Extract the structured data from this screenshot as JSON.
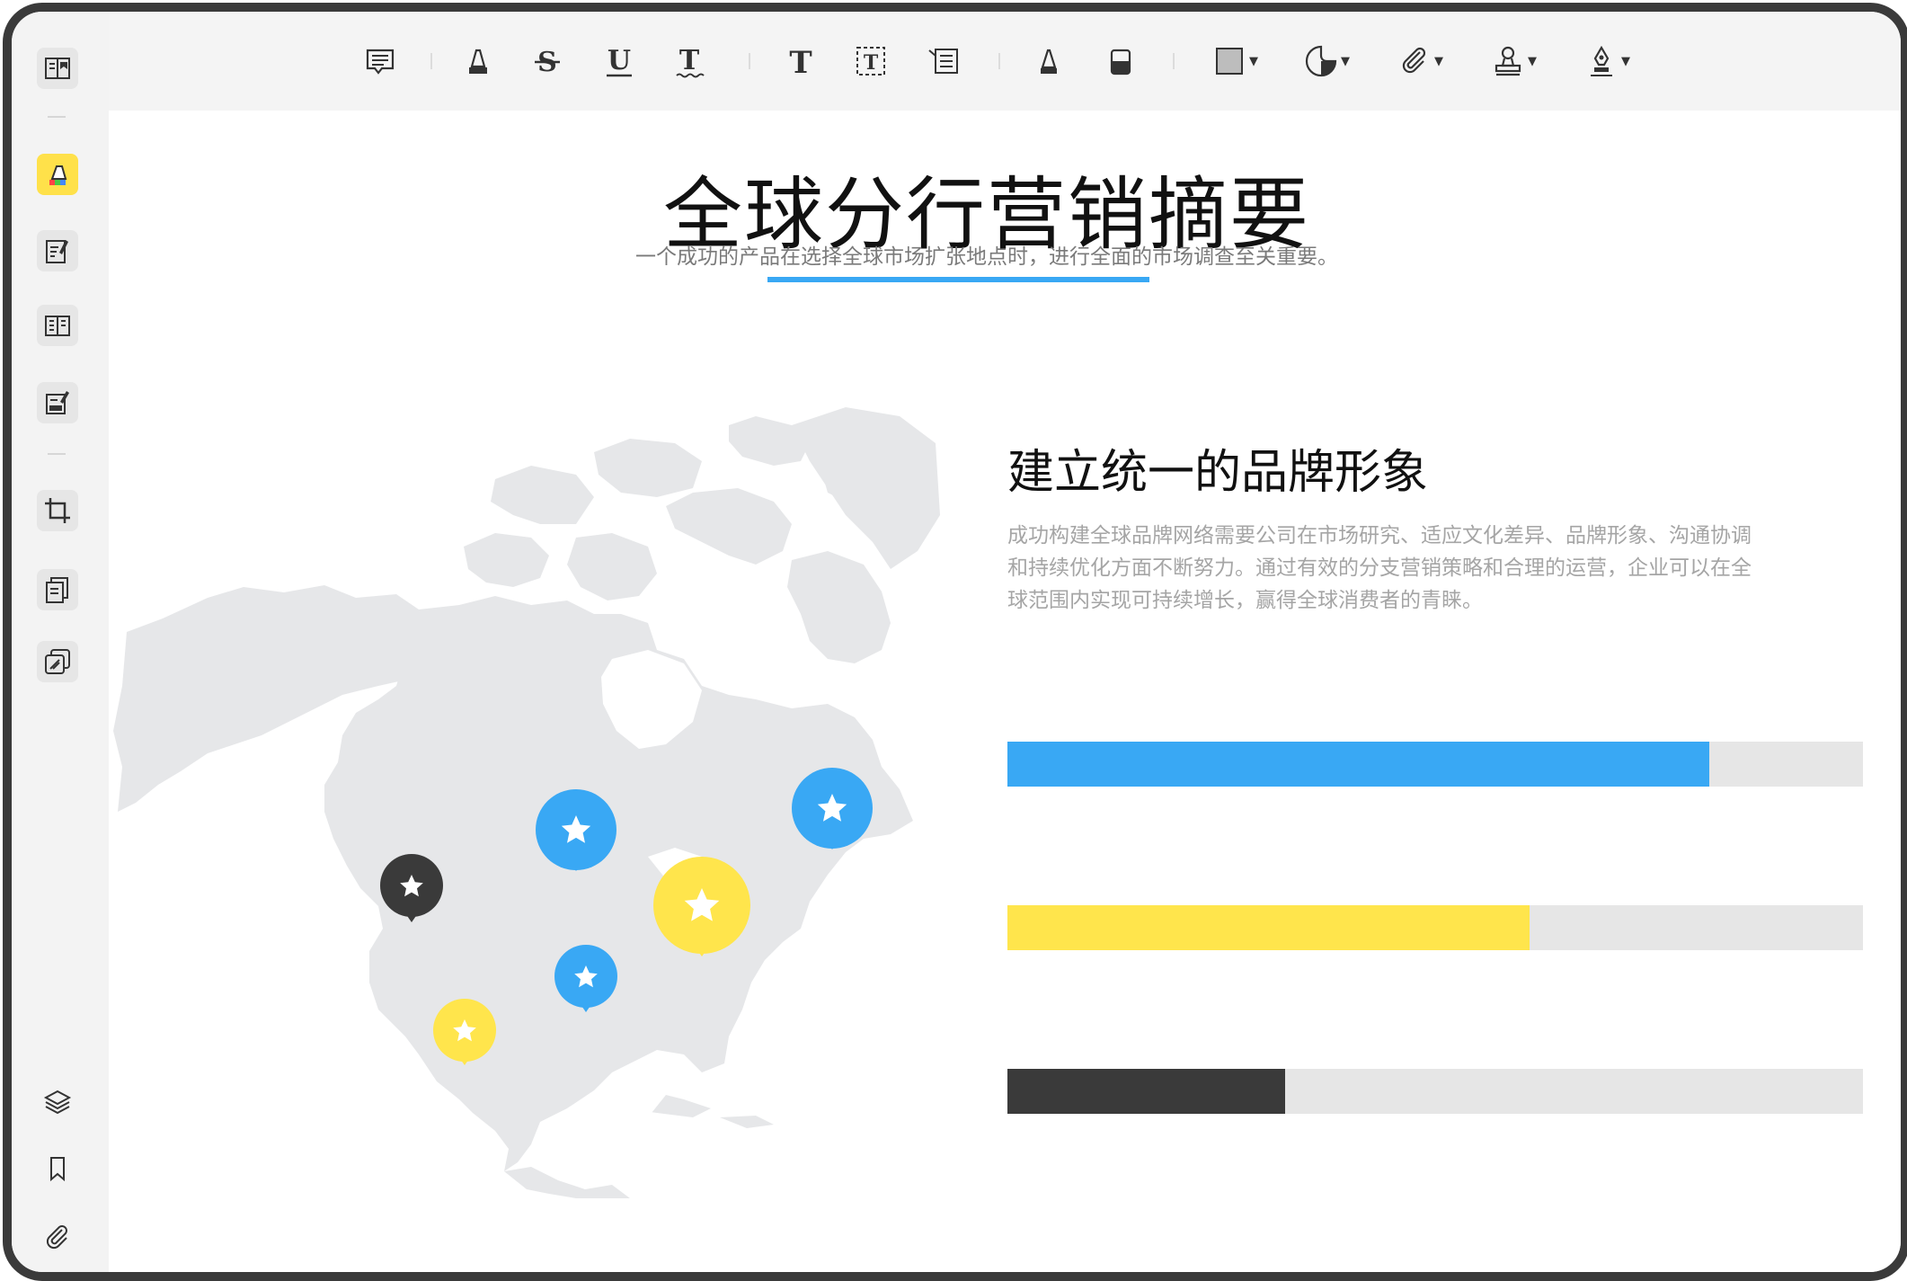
{
  "toolbar": {
    "tools": [
      {
        "name": "note-icon"
      },
      {
        "name": "highlight-icon"
      },
      {
        "name": "strikethrough-icon"
      },
      {
        "name": "underline-icon"
      },
      {
        "name": "squiggly-icon"
      },
      {
        "name": "text-icon"
      },
      {
        "name": "textbox-icon"
      },
      {
        "name": "callout-icon"
      },
      {
        "name": "pen-icon"
      },
      {
        "name": "eraser-icon"
      },
      {
        "name": "shape-icon"
      },
      {
        "name": "sticker-icon"
      },
      {
        "name": "attachment-icon"
      },
      {
        "name": "stamp-icon"
      },
      {
        "name": "signature-icon"
      }
    ]
  },
  "sidebar": {
    "items": [
      {
        "name": "reader-icon"
      },
      {
        "name": "comment-mode-icon",
        "active": true
      },
      {
        "name": "edit-icon"
      },
      {
        "name": "organize-pages-icon"
      },
      {
        "name": "fill-sign-icon"
      },
      {
        "name": "crop-icon"
      },
      {
        "name": "convert-icon"
      },
      {
        "name": "compress-icon"
      },
      {
        "name": "layers-icon"
      },
      {
        "name": "bookmark-icon"
      },
      {
        "name": "attachments-icon"
      }
    ]
  },
  "document": {
    "title": "全球分行营销摘要",
    "subtitle": "一个成功的产品在选择全球市场扩张地点时，进行全面的市场调查至关重要。",
    "section_heading": "建立统一的品牌形象",
    "section_text": "成功构建全球品牌网络需要公司在市场研究、适应文化差异、品牌形象、沟通协调和持续优化方面不断努力。通过有效的分支营销策略和合理的运营，企业可以在全球范围内实现可持续增长，赢得全球消费者的青睐。",
    "bars": [
      {
        "fraction": 0.82,
        "color": "#39a8f4"
      },
      {
        "fraction": 0.61,
        "color": "#ffe54c"
      },
      {
        "fraction": 0.325,
        "color": "#3a3a3a"
      }
    ]
  },
  "colors": {
    "accent_blue": "#39a8f4",
    "accent_yellow": "#ffe54c",
    "dark": "#3a3a3a",
    "map_fill": "#e6e7e9"
  }
}
